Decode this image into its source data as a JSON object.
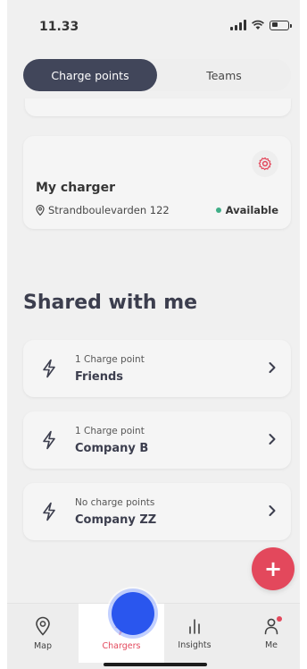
{
  "status_bar": {
    "time": "11.33"
  },
  "segment": {
    "tabs": [
      "Charge points",
      "Teams"
    ]
  },
  "my_charger": {
    "name": "My charger",
    "address": "Strandboulevarden 122",
    "status": "Available"
  },
  "shared": {
    "title": "Shared with me",
    "teams": [
      {
        "subtitle": "1 Charge point",
        "name": "Friends"
      },
      {
        "subtitle": "1 Charge point",
        "name": "Company B"
      },
      {
        "subtitle": "No charge points",
        "name": "Company ZZ"
      }
    ]
  },
  "fab": {
    "label": "+"
  },
  "nav": {
    "items": [
      {
        "label": "Map",
        "icon": "map-pin-icon"
      },
      {
        "label": "Chargers",
        "icon": "bolt-icon"
      },
      {
        "label": "Insights",
        "icon": "bar-chart-icon"
      },
      {
        "label": "Me",
        "icon": "person-icon"
      }
    ]
  },
  "colors": {
    "accent": "#e0344a",
    "primary_dark": "#2c3148",
    "available": "#2aa57a",
    "touch_indicator": "#2a56ee"
  }
}
